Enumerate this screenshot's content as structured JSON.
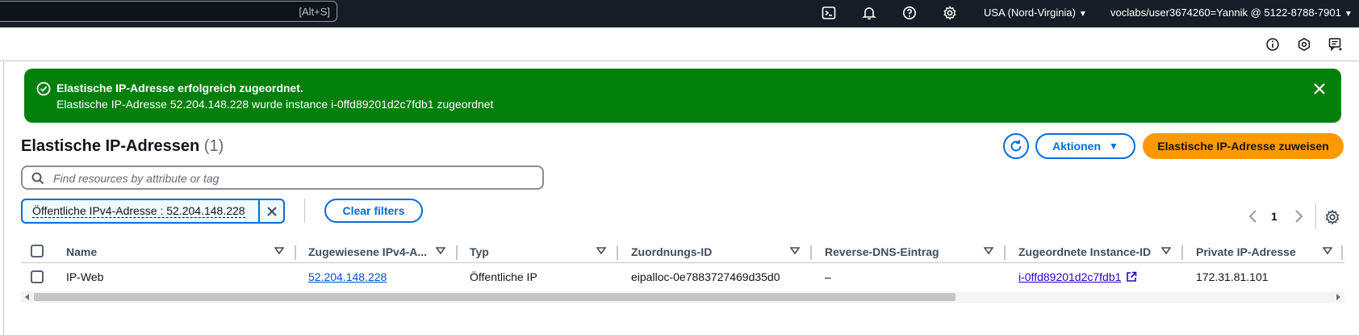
{
  "topbar": {
    "search_shortcut": "[Alt+S]",
    "region": "USA (Nord-Virginia)",
    "account": "voclabs/user3674260=Yannik @ 5122-8788-7901"
  },
  "flash": {
    "title": "Elastische IP-Adresse erfolgreich zugeordnet.",
    "message": "Elastische IP-Adresse 52.204.148.228 wurde instance i-0ffd89201d2c7fdb1 zugeordnet",
    "color": "#037f0c"
  },
  "page": {
    "title": "Elastische IP-Adressen",
    "count": "(1)",
    "actions_label": "Aktionen",
    "primary_label": "Elastische IP-Adresse zuweisen",
    "filter_placeholder": "Find resources by attribute or tag",
    "token_label": "Öffentliche IPv4-Adresse : 52.204.148.228",
    "clear_filters_label": "Clear filters",
    "current_page": "1"
  },
  "table": {
    "columns": [
      "Name",
      "Zugewiesene IPv4-A...",
      "Typ",
      "Zuordnungs-ID",
      "Reverse-DNS-Eintrag",
      "Zugeordnete Instance-ID",
      "Private IP-Adresse"
    ],
    "rows": [
      {
        "name": "IP-Web",
        "ipv4": "52.204.148.228",
        "type": "Öffentliche IP",
        "association_id": "eipalloc-0e7883727469d35d0",
        "reverse_dns": "–",
        "instance_id": "i-0ffd89201d2c7fdb1",
        "private_ip": "172.31.81.101"
      }
    ]
  },
  "colors": {
    "nav_bg": "#161d26",
    "accent": "#006ce0",
    "primary": "#ff9900",
    "success": "#037f0c"
  }
}
